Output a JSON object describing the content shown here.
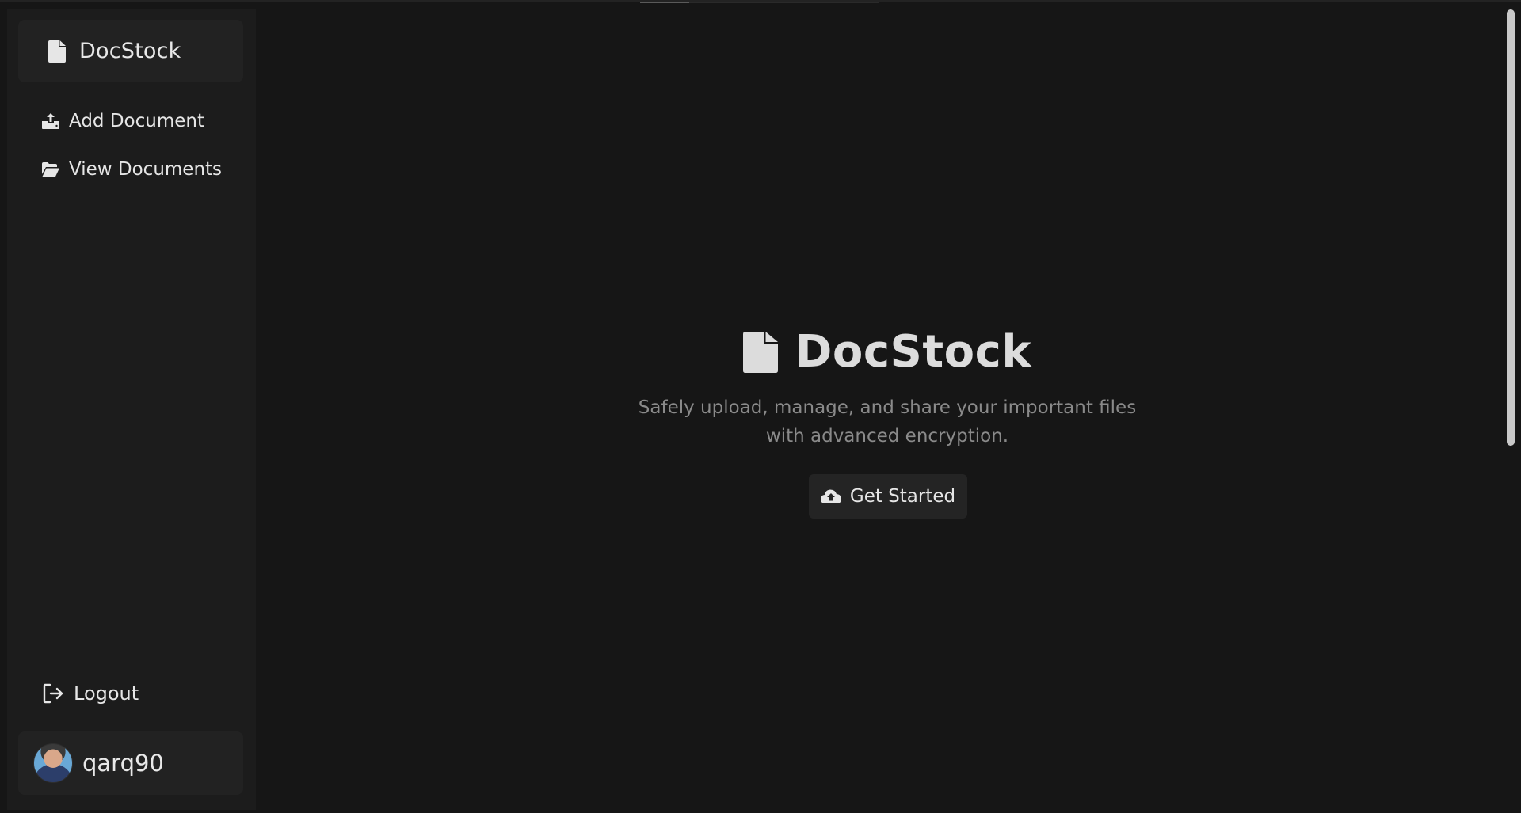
{
  "sidebar": {
    "brand": {
      "name": "DocStock",
      "icon": "file-icon"
    },
    "items": [
      {
        "label": "Add Document",
        "icon": "upload-tray-icon"
      },
      {
        "label": "View Documents",
        "icon": "folder-open-icon"
      }
    ],
    "logout": {
      "label": "Logout",
      "icon": "sign-out-icon"
    },
    "user": {
      "username": "qarq90",
      "avatar": "avatar"
    }
  },
  "hero": {
    "title": "DocStock",
    "subtitle_line1": "Safely upload, manage, and share your important files",
    "subtitle_line2": "with advanced encryption.",
    "cta_label": "Get Started",
    "cta_icon": "cloud-upload-icon"
  },
  "colors": {
    "background": "#161616",
    "sidebar": "#1c1c1c",
    "card": "#222222",
    "text": "#e6e6e6",
    "muted": "#8a8a8a"
  }
}
